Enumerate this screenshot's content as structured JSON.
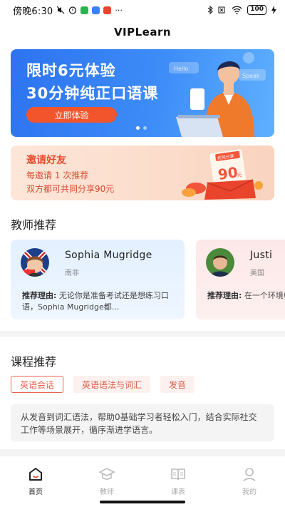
{
  "status_bar": {
    "time": "傍晚6:30",
    "battery": "100",
    "more": "···"
  },
  "app_title": "VIPLearn",
  "banner": {
    "title_line1": "限时6元体验",
    "title_line2": "30分钟纯正口语课",
    "button": "立即体验",
    "bubble_hello": "Hello",
    "bubble_speak": "Speak"
  },
  "invite": {
    "title": "邀请好友",
    "line1": "每邀请 1 次推荐",
    "line2": "双方都可共同分享90元",
    "badge_label": "共同分享",
    "badge_amount": "90",
    "badge_unit": "元"
  },
  "teachers": {
    "section_title": "教师推荐",
    "items": [
      {
        "name": "Sophia Mugridge",
        "country": "南非",
        "reason_label": "推荐理由:",
        "reason_text": "无论你是准备考试还是想练习口语，Sophia Mugridge都..."
      },
      {
        "name": "Justi",
        "country": "美国",
        "reason_label": "推荐理由:",
        "reason_text": "在一个环境中提高你的"
      }
    ]
  },
  "courses": {
    "section_title": "课程推荐",
    "tabs": [
      {
        "label": "英语会话",
        "active": true
      },
      {
        "label": "英语语法与词汇",
        "active": false
      },
      {
        "label": "发音",
        "active": false
      }
    ],
    "description": "从发音到词汇语法，帮助0基础学习者轻松入门，结合实际社交工作等场景展开，循序渐进学语言。"
  },
  "bottom_nav": [
    {
      "label": "首页",
      "icon": "home-icon",
      "active": true
    },
    {
      "label": "教师",
      "icon": "graduation-cap-icon",
      "active": false
    },
    {
      "label": "课表",
      "icon": "book-icon",
      "active": false
    },
    {
      "label": "我的",
      "icon": "person-icon",
      "active": false
    }
  ],
  "colors": {
    "accent": "#e8624c",
    "banner_blue": "#3d8cf8",
    "banner_button": "#f2552c"
  }
}
